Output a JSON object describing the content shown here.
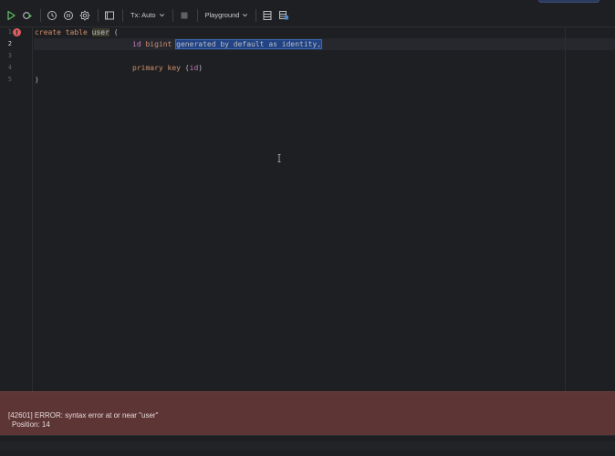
{
  "toolbar": {
    "tx_label": "Tx: Auto",
    "session_label": "Playground",
    "icons": [
      "run-icon",
      "execute-plan-icon",
      "history-icon",
      "pause-icon",
      "settings-icon",
      "output-icon",
      "stop-icon",
      "table-icon",
      "console-schema-icon"
    ]
  },
  "editor": {
    "lines": [
      {
        "num": "1",
        "has_error": true
      },
      {
        "num": "2",
        "active": true
      },
      {
        "num": "3"
      },
      {
        "num": "4"
      },
      {
        "num": "5"
      }
    ],
    "error_marker": "!",
    "code": {
      "l1_kw": "create table",
      "l1_ident": "user",
      "l1_rest": " (",
      "l2_col": "id",
      "l2_type": " bigint ",
      "l2_selected": "generated by default as identity,",
      "l4_kw": "primary key",
      "l4_paren_open": " (",
      "l4_col": "id",
      "l4_paren_close": ")",
      "l5": ")"
    }
  },
  "error_panel": {
    "message": "[42601] ERROR: syntax error at or near \"user\"",
    "position": "Position: 14",
    "background": "#5e3535"
  },
  "colors": {
    "background": "#1e1f22",
    "keyword": "#cf8e6d",
    "selection": "#214283",
    "error": "#db5c5c"
  }
}
